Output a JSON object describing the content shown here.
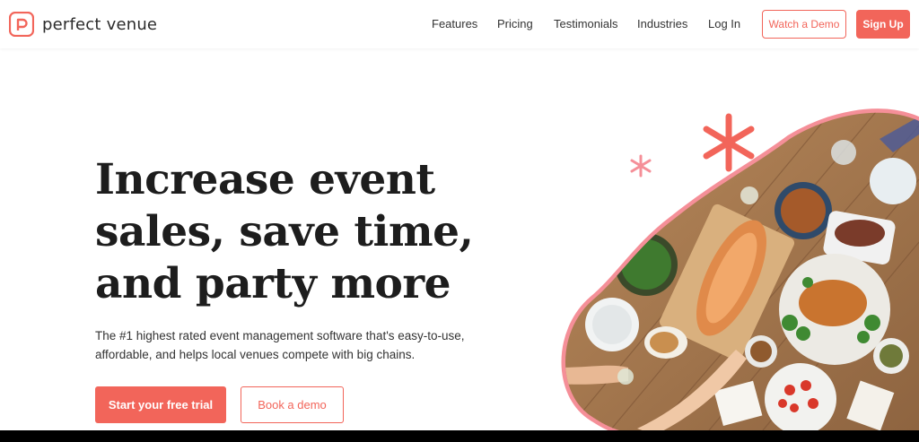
{
  "brand": {
    "name": "perfect venue",
    "accent_color": "#f2655a",
    "icon": "p-logo-icon"
  },
  "nav": {
    "links": [
      "Features",
      "Pricing",
      "Testimonials",
      "Industries",
      "Log In"
    ],
    "watch_demo": "Watch a Demo",
    "sign_up": "Sign Up"
  },
  "hero": {
    "title_lines": [
      "Increase event",
      "sales, save time,",
      "and party more"
    ],
    "subtitle_lines": [
      "The #1 highest rated event management software that's easy-to-use,",
      "affordable, and helps local venues compete with big chains."
    ],
    "primary_cta": "Start your free trial",
    "secondary_cta": "Book a demo",
    "image": "dinner-table-food-photo",
    "decorations": [
      "asterisk-icon",
      "asterisk-icon"
    ]
  }
}
